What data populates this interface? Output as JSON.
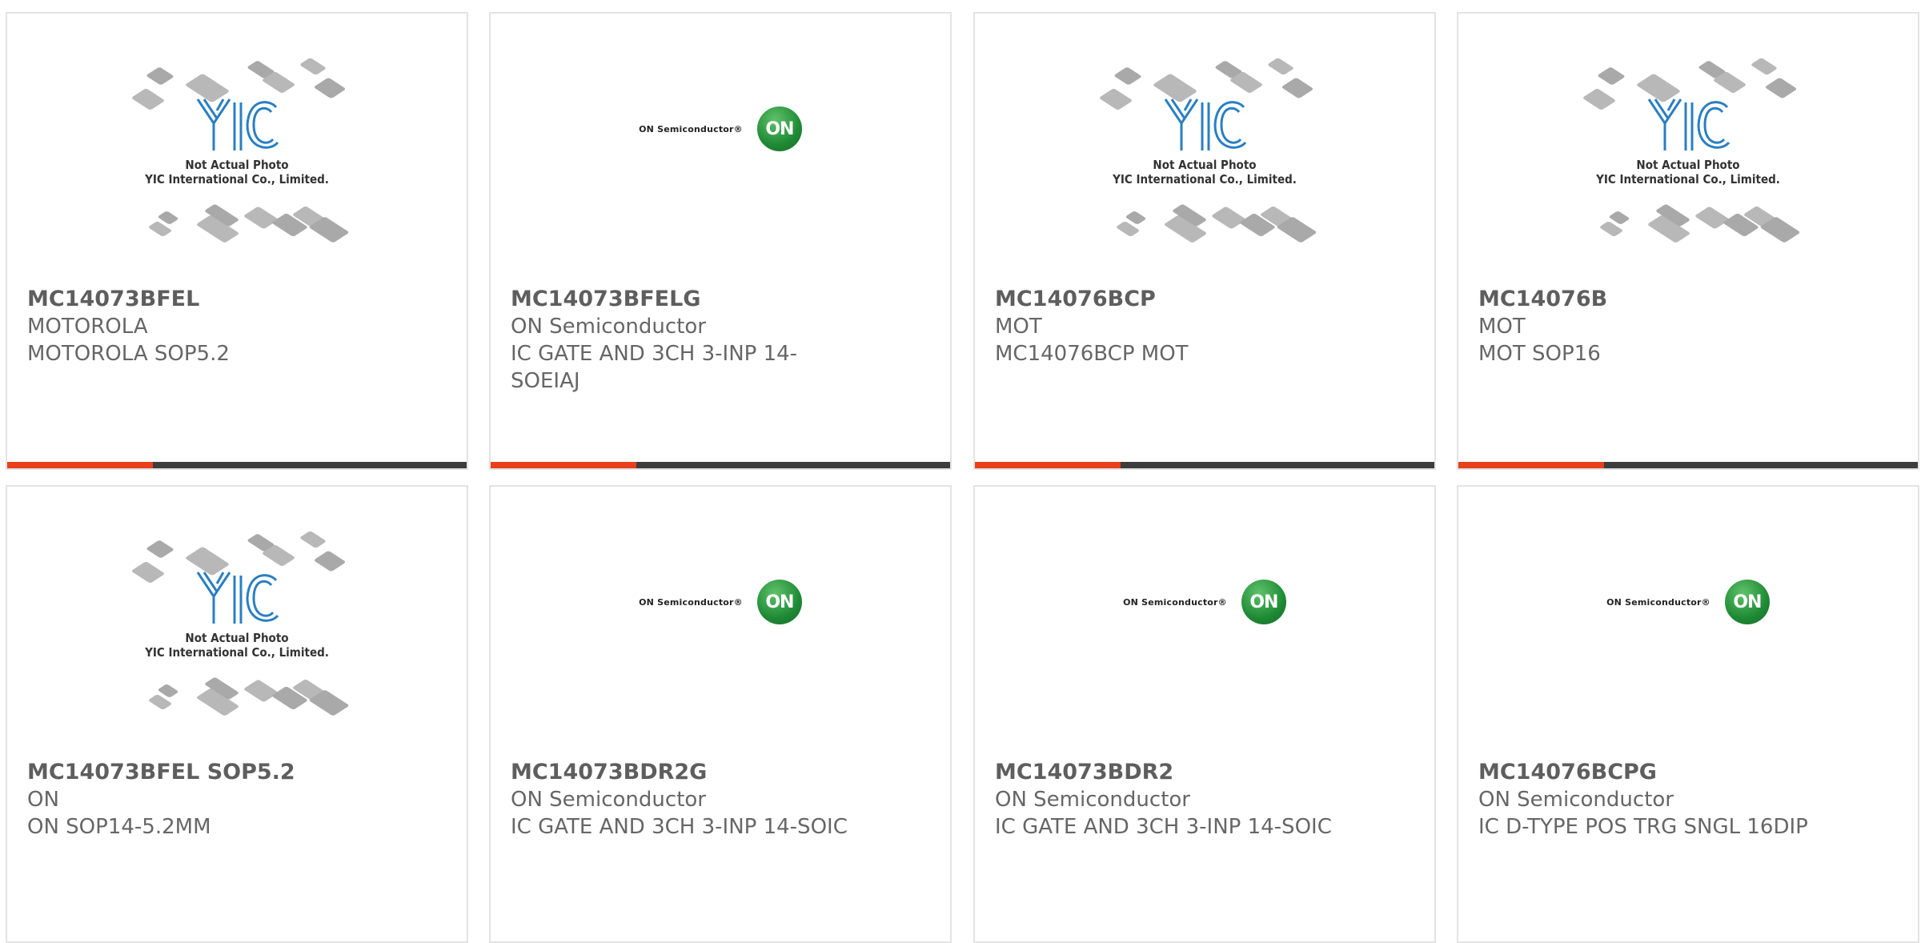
{
  "colors": {
    "accent": "#e8401c",
    "bar": "#3d3d3d",
    "text": "#666666"
  },
  "cards": [
    {
      "part": "MC14073BFEL",
      "maker": "MOTOROLA",
      "desc": "MOTOROLA SOP5.2",
      "image": "yic-placeholder"
    },
    {
      "part": "MC14073BFELG",
      "maker": "ON Semiconductor",
      "desc": "IC GATE AND 3CH 3-INP 14-SOEIAJ",
      "image": "on-semi-logo"
    },
    {
      "part": "MC14076BCP",
      "maker": "MOT",
      "desc": "MC14076BCP MOT",
      "image": "yic-placeholder"
    },
    {
      "part": "MC14076B",
      "maker": "MOT",
      "desc": "MOT SOP16",
      "image": "yic-placeholder"
    },
    {
      "part": "MC14073BFEL SOP5.2",
      "maker": "ON",
      "desc": "ON SOP14-5.2MM",
      "image": "yic-placeholder"
    },
    {
      "part": "MC14073BDR2G",
      "maker": "ON Semiconductor",
      "desc": "IC GATE AND 3CH 3-INP 14-SOIC",
      "image": "on-semi-logo"
    },
    {
      "part": "MC14073BDR2",
      "maker": "ON Semiconductor",
      "desc": "IC GATE AND 3CH 3-INP 14-SOIC",
      "image": "on-semi-logo"
    },
    {
      "part": "MC14076BCPG",
      "maker": "ON Semiconductor",
      "desc": "IC D-TYPE POS TRG SNGL 16DIP",
      "image": "on-semi-logo"
    }
  ],
  "placeholder": {
    "line1": "Not Actual Photo",
    "line2": "YIC International Co., Limited."
  },
  "on_logo": {
    "wordmark": "ON Semiconductor®",
    "badge": "ON"
  }
}
